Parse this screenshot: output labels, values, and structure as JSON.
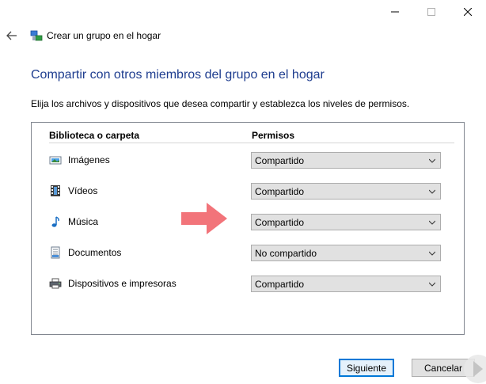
{
  "window": {
    "nav_title": "Crear un grupo en el hogar"
  },
  "page": {
    "heading": "Compartir con otros miembros del grupo en el hogar",
    "instructions": "Elija los archivos y dispositivos que desea compartir y establezca los niveles de permisos."
  },
  "table": {
    "headers": [
      "Biblioteca o carpeta",
      "Permisos"
    ],
    "rows": [
      {
        "label": "Imágenes",
        "icon": "pictures-icon",
        "permission": "Compartido"
      },
      {
        "label": "Vídeos",
        "icon": "videos-icon",
        "permission": "Compartido"
      },
      {
        "label": "Música",
        "icon": "music-icon",
        "permission": "Compartido"
      },
      {
        "label": "Documentos",
        "icon": "documents-icon",
        "permission": "No compartido"
      },
      {
        "label": "Dispositivos e impresoras",
        "icon": "printer-icon",
        "permission": "Compartido"
      }
    ]
  },
  "buttons": {
    "next": "Siguiente",
    "cancel": "Cancelar"
  },
  "colors": {
    "heading": "#1e3d8f",
    "arrow": "#f2747a",
    "focus": "#0078d7"
  }
}
